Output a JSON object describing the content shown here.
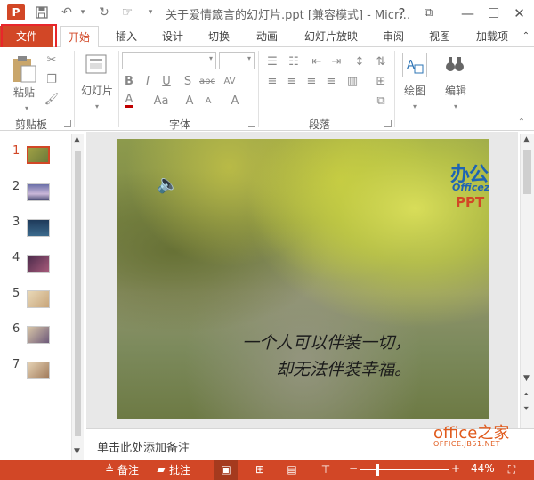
{
  "titlebar": {
    "app_icon": "P",
    "title": "关于爱情箴言的幻灯片.ppt [兼容模式] - Micr…",
    "icons": [
      "save-icon",
      "undo-icon",
      "redo-icon",
      "touch-mode-icon",
      "customize-qat-icon"
    ],
    "window_buttons": [
      "?",
      "⧉",
      "—",
      "☐",
      "✕"
    ]
  },
  "tabs": {
    "file": "文件",
    "items": [
      "开始",
      "插入",
      "设计",
      "切换",
      "动画",
      "幻灯片放映",
      "审阅",
      "视图",
      "加载项"
    ]
  },
  "ribbon": {
    "clipboard": {
      "paste": "粘贴",
      "label": "剪贴板"
    },
    "slides": {
      "label": "幻灯片"
    },
    "font": {
      "label": "字体",
      "bold": "B",
      "italic": "I",
      "underline": "U",
      "strike": "S",
      "abc": "abc",
      "av": "AV",
      "aa": "Aa"
    },
    "paragraph": {
      "label": "段落"
    },
    "drawing": {
      "label": "绘图"
    },
    "editing": {
      "label": "编辑"
    }
  },
  "thumbnails": [
    "1",
    "2",
    "3",
    "4",
    "5",
    "6",
    "7"
  ],
  "slide": {
    "line1": "一个人可以伴装一切，",
    "line2": "却无法伴装幸福。",
    "watermark_cn": "办公",
    "watermark_en": "Officez",
    "watermark_ppt": "PPT"
  },
  "notes": {
    "placeholder": "单击此处添加备注"
  },
  "site_watermark": {
    "name": "office之家",
    "url": "OFFICE.JB51.NET"
  },
  "statusbar": {
    "notes": "备注",
    "comments": "批注",
    "zoom_minus": "−",
    "zoom_plus": "+",
    "zoom": "44%",
    "zoom_fraction": 0.44
  },
  "colors": {
    "accent": "#d24726",
    "file_outline": "#e8262b"
  }
}
